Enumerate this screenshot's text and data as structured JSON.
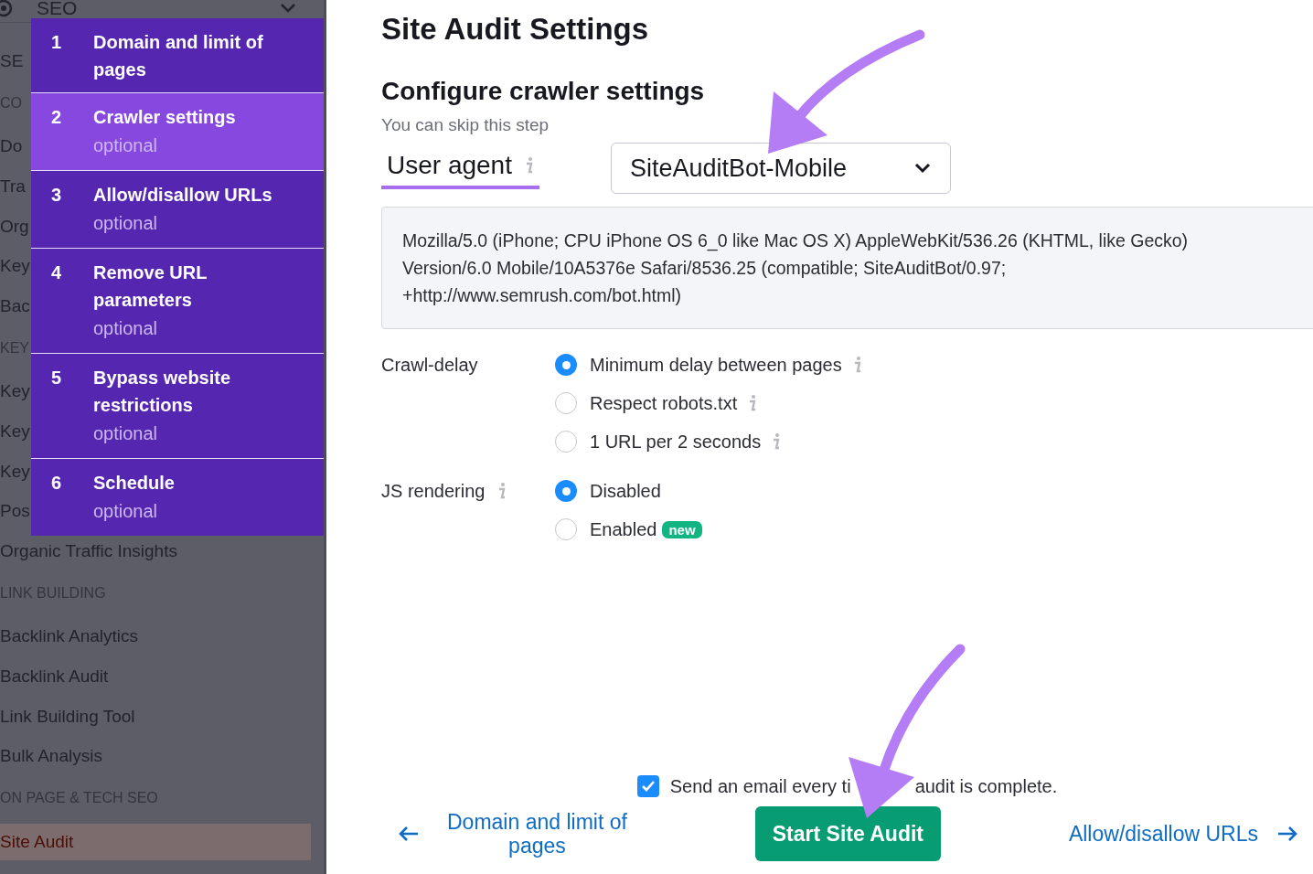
{
  "sidebar": {
    "header": {
      "label": "SEO"
    },
    "items": [
      {
        "kind": "link",
        "label": "SE",
        "selected": false
      },
      {
        "kind": "section",
        "label": "CO"
      },
      {
        "kind": "link",
        "label": "Do",
        "selected": false
      },
      {
        "kind": "link",
        "label": "Tra",
        "selected": false
      },
      {
        "kind": "link",
        "label": "Org",
        "selected": false
      },
      {
        "kind": "link",
        "label": "Key",
        "selected": false
      },
      {
        "kind": "link",
        "label": "Bac",
        "selected": false
      },
      {
        "kind": "section",
        "label": "KEY"
      },
      {
        "kind": "link",
        "label": "Key",
        "selected": false
      },
      {
        "kind": "link",
        "label": "Key",
        "selected": false
      },
      {
        "kind": "link",
        "label": "Key",
        "selected": false
      },
      {
        "kind": "link",
        "label": "Pos",
        "selected": false
      },
      {
        "kind": "link",
        "label": "Organic Traffic Insights",
        "selected": false
      },
      {
        "kind": "section",
        "label": "LINK BUILDING"
      },
      {
        "kind": "link",
        "label": "Backlink Analytics",
        "selected": false
      },
      {
        "kind": "link",
        "label": "Backlink Audit",
        "selected": false
      },
      {
        "kind": "link",
        "label": "Link Building Tool",
        "selected": false
      },
      {
        "kind": "link",
        "label": "Bulk Analysis",
        "selected": false
      },
      {
        "kind": "section",
        "label": "ON PAGE & TECH SEO"
      },
      {
        "kind": "link",
        "label": "Site Audit",
        "selected": true
      }
    ]
  },
  "steps": [
    {
      "number": "1",
      "title_lines": [
        "Domain and limit of",
        "pages"
      ],
      "selected": false
    },
    {
      "number": "2",
      "title_lines": [
        "Crawler settings"
      ],
      "note": "optional",
      "selected": true
    },
    {
      "number": "3",
      "title_lines": [
        "Allow/disallow URLs"
      ],
      "note": "optional",
      "selected": false
    },
    {
      "number": "4",
      "title_lines": [
        "Remove URL",
        "parameters"
      ],
      "note": "optional",
      "selected": false
    },
    {
      "number": "5",
      "title_lines": [
        "Bypass website",
        "restrictions"
      ],
      "note": "optional",
      "selected": false
    },
    {
      "number": "6",
      "title_lines": [
        "Schedule"
      ],
      "note": "optional",
      "selected": false
    }
  ],
  "title": "Site Audit Settings",
  "section": {
    "title": "Configure crawler settings",
    "subtitle": "You can skip this step"
  },
  "user_agent": {
    "tab": "User agent",
    "selected": true,
    "value": "SiteAuditBot-Mobile",
    "string_lines": [
      "Mozilla/5.0 (iPhone; CPU iPhone OS 6_0 like Mac OS X) AppleWebKit/536.26 (KHTML, like Gecko)",
      "Version/6.0 Mobile/10A5376e Safari/8536.25 (compatible; SiteAuditBot/0.97;",
      "+http://www.semrush.com/bot.html)"
    ]
  },
  "option_groups": [
    {
      "label": "Crawl-delay",
      "info": false,
      "options": [
        {
          "label": "Minimum delay between pages",
          "info": true,
          "selected": true
        },
        {
          "label": "Respect robots.txt",
          "info": true,
          "selected": false
        },
        {
          "label": "1 URL per 2 seconds",
          "info": true,
          "selected": false
        }
      ]
    },
    {
      "label": "JS rendering",
      "info": true,
      "options": [
        {
          "label": "Disabled",
          "info": false,
          "selected": true
        },
        {
          "label": "Enabled",
          "info": false,
          "badge": "new",
          "selected": false
        }
      ]
    }
  ],
  "email": {
    "checked": true,
    "text_parts": [
      "Send an email every ti",
      "audit is complete."
    ]
  },
  "footer": {
    "back_lines": [
      "Domain and limit of",
      "pages"
    ],
    "start": "Start Site Audit",
    "next": "Allow/disallow URLs"
  }
}
